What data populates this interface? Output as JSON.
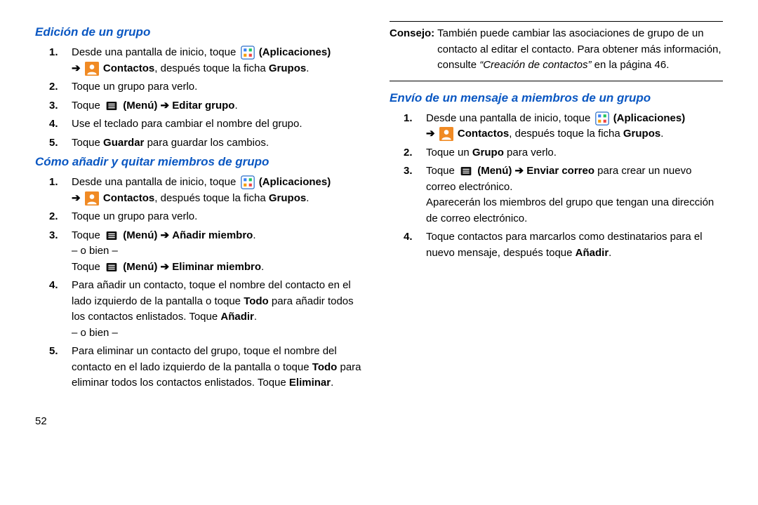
{
  "page_number": "52",
  "arrow": "➔",
  "icons": {
    "apps": "apps-grid-icon",
    "contacts": "contacts-person-icon",
    "menu": "menu-lines-icon"
  },
  "labels": {
    "aplicaciones": "(Aplicaciones)",
    "contactos": "Contactos",
    "menu": "(Menú)",
    "grupos": "Grupos",
    "guardar": "Guardar",
    "todo": "Todo",
    "anadir": "Añadir",
    "eliminar": "Eliminar",
    "grupo": "Grupo"
  },
  "left": {
    "section1_title": "Edición de un grupo",
    "s1_step1_a": "Desde una pantalla de inicio, toque ",
    "s1_step1_b": ", después toque la ficha ",
    "s1_step2": "Toque un grupo para verlo.",
    "s1_step3_a": "Toque ",
    "s1_step3_b": " Editar grupo",
    "s1_step4": "Use el teclado para cambiar el nombre del grupo.",
    "s1_step5_a": "Toque ",
    "s1_step5_b": " para guardar los cambios.",
    "section2_title": "Cómo añadir y quitar miembros de grupo",
    "s2_step1_a": "Desde una pantalla de inicio, toque ",
    "s2_step1_b": ", después toque la ficha ",
    "s2_step2": "Toque un grupo para verlo.",
    "s2_step3_a": "Toque ",
    "s2_step3_b": " Añadir miembro",
    "s2_or": "– o bien –",
    "s2_step3_c": "Toque ",
    "s2_step3_d": " Eliminar miembro",
    "s2_step4_a": "Para añadir un contacto, toque el nombre del contacto en el lado izquierdo de la pantalla o toque ",
    "s2_step4_b": " para añadir todos los contactos enlistados. Toque ",
    "s2_step5_a": "Para eliminar un contacto del grupo, toque el nombre del contacto en el lado izquierdo de la pantalla o toque ",
    "s2_step5_b": " para eliminar todos los contactos enlistados. Toque "
  },
  "right": {
    "tip_label": "Consejo:",
    "tip_text_a": "También puede cambiar las asociaciones de grupo de un contacto al editar el contacto. Para obtener más información, consulte ",
    "tip_text_link": "“Creación de contactos”",
    "tip_text_b": " en la página 46.",
    "section3_title": "Envío de un mensaje a miembros de un grupo",
    "s3_step1_a": "Desde una pantalla de inicio, toque ",
    "s3_step1_b": ", después toque la ficha ",
    "s3_step2_a": "Toque un ",
    "s3_step2_b": " para verlo.",
    "s3_step3_a": "Toque ",
    "s3_step3_b": " Enviar correo",
    "s3_step3_c": " para crear un nuevo correo electrónico.",
    "s3_step3_d": "Aparecerán los miembros del grupo que tengan una dirección de correo electrónico.",
    "s3_step4_a": "Toque contactos para marcarlos como destinatarios para el nuevo mensaje, después toque "
  }
}
